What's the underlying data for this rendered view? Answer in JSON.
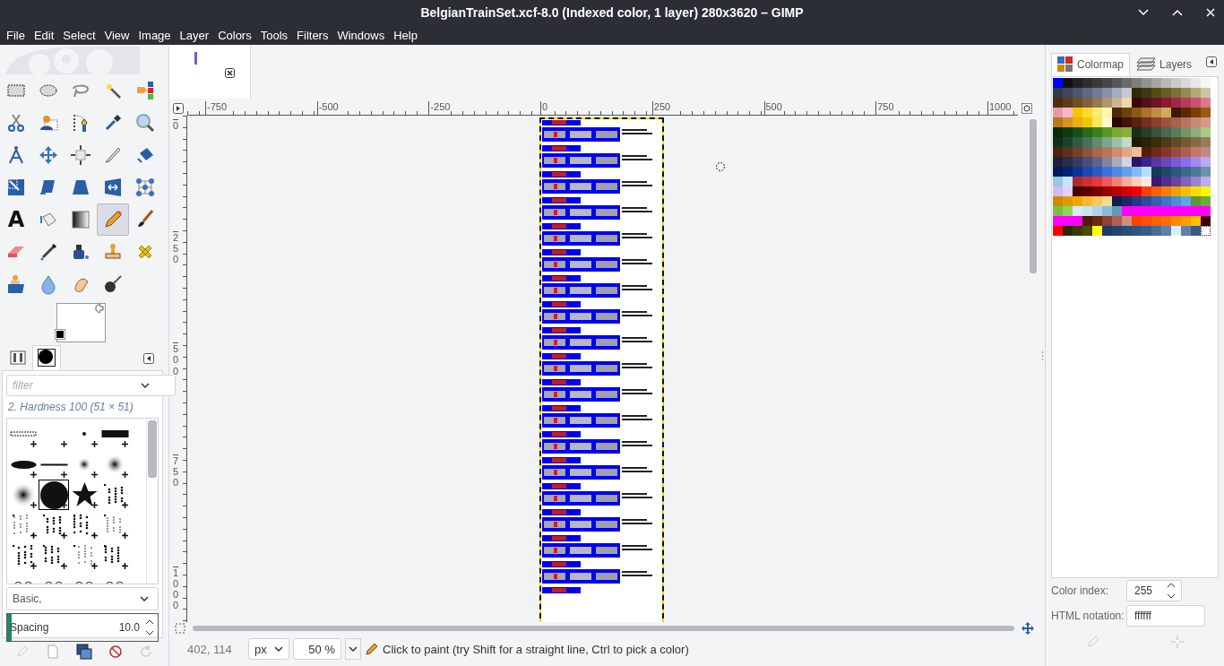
{
  "window": {
    "title": "BelgianTrainSet.xcf-8.0 (Indexed color, 1 layer) 280x3620 – GIMP"
  },
  "menu": [
    "File",
    "Edit",
    "Select",
    "View",
    "Image",
    "Layer",
    "Colors",
    "Tools",
    "Filters",
    "Windows",
    "Help"
  ],
  "toolbox": {
    "tools": [
      {
        "selected": false
      },
      {
        "selected": false
      },
      {
        "selected": false
      },
      {
        "selected": false
      },
      {
        "selected": false
      },
      {
        "selected": false
      },
      {
        "selected": false
      },
      {
        "selected": false
      },
      {
        "selected": false
      },
      {
        "selected": false
      },
      {
        "selected": false
      },
      {
        "selected": false
      },
      {
        "selected": false
      },
      {
        "selected": false
      },
      {
        "selected": false
      },
      {
        "selected": false
      },
      {
        "selected": false
      },
      {
        "selected": false
      },
      {
        "selected": false
      },
      {
        "selected": false
      },
      {
        "selected": false,
        "glyph": "A"
      },
      {
        "selected": false
      },
      {
        "selected": false
      },
      {
        "selected": true
      },
      {
        "selected": false
      },
      {
        "selected": false
      },
      {
        "selected": false
      },
      {
        "selected": false
      },
      {
        "selected": false
      },
      {
        "selected": false
      },
      {
        "selected": false
      },
      {
        "selected": false
      },
      {
        "selected": false
      },
      {
        "selected": false
      }
    ],
    "foreground": {
      "color": "#ffffff"
    },
    "background": {
      "color": "#000000"
    }
  },
  "left_dock": {
    "tabs": [
      {
        "selected": false
      },
      {
        "selected": true
      }
    ],
    "filter": {
      "placeholder": "filter"
    },
    "brush_name": "2. Hardness 100 (51 × 51)",
    "brushes": [
      {
        "selected": false
      },
      {
        "selected": false
      },
      {
        "selected": false
      },
      {
        "selected": false
      },
      {
        "selected": false
      },
      {
        "selected": false
      },
      {
        "selected": false
      },
      {
        "selected": false
      },
      {
        "selected": false
      },
      {
        "selected": true
      },
      {
        "selected": false
      },
      {
        "selected": false
      },
      {
        "selected": false
      },
      {
        "selected": false
      },
      {
        "selected": false
      },
      {
        "selected": false
      },
      {
        "selected": false
      },
      {
        "selected": false
      },
      {
        "selected": false
      },
      {
        "selected": false
      },
      {
        "selected": false
      },
      {
        "selected": false
      },
      {
        "selected": false
      },
      {
        "selected": false
      }
    ],
    "tag_filter": "Basic,",
    "spacing": {
      "label": "Spacing",
      "value": "10.0",
      "level": 0.03
    }
  },
  "rulers": {
    "horizontal": [
      "-750",
      "-500",
      "-250",
      "0",
      "250",
      "500",
      "750",
      "1000"
    ],
    "vertical": [
      "0",
      "250",
      "500",
      "750",
      "1000"
    ]
  },
  "status_bar": {
    "coordinates": "402, 114",
    "unit": "px",
    "zoom": "50 %",
    "message": "Click to paint (try Shift for a straight line, Ctrl to pick a color)"
  },
  "right_dock": {
    "tabs": [
      {
        "label": "Colormap",
        "selected": true
      },
      {
        "label": "Layers",
        "selected": false
      }
    ],
    "colormap": [
      [
        {
          "color": "#0000ff"
        },
        {
          "color": "#111111"
        },
        {
          "color": "#222222"
        },
        {
          "color": "#2e2e2e"
        },
        {
          "color": "#3a3a3a"
        },
        {
          "color": "#474747"
        },
        {
          "color": "#575757"
        },
        {
          "color": "#6a6a6a"
        },
        {
          "color": "#7d7d7d"
        },
        {
          "color": "#919191"
        },
        {
          "color": "#a5a5a5"
        },
        {
          "color": "#b8b8b8"
        },
        {
          "color": "#cacaca"
        },
        {
          "color": "#dadada"
        },
        {
          "color": "#e8e8e8"
        },
        {
          "color": "#f6f6f6"
        }
      ],
      [
        {
          "color": "#333a4a"
        },
        {
          "color": "#3f4659"
        },
        {
          "color": "#4e566c"
        },
        {
          "color": "#5f6880"
        },
        {
          "color": "#707a94"
        },
        {
          "color": "#8891a8"
        },
        {
          "color": "#a5adc0"
        },
        {
          "color": "#c4c9d6"
        },
        {
          "color": "#2e2a0a"
        },
        {
          "color": "#3e3a10"
        },
        {
          "color": "#524c18"
        },
        {
          "color": "#675f22"
        },
        {
          "color": "#7a7236"
        },
        {
          "color": "#938b55"
        },
        {
          "color": "#aea977"
        },
        {
          "color": "#c9c6a0"
        }
      ],
      [
        {
          "color": "#4a3010"
        },
        {
          "color": "#5c3d17"
        },
        {
          "color": "#6f4e25"
        },
        {
          "color": "#806139"
        },
        {
          "color": "#967752"
        },
        {
          "color": "#b09470"
        },
        {
          "color": "#cfb48f"
        },
        {
          "color": "#f0d9a8"
        },
        {
          "color": "#3a0a0a"
        },
        {
          "color": "#55101a"
        },
        {
          "color": "#6e1425"
        },
        {
          "color": "#881c33"
        },
        {
          "color": "#a02a45"
        },
        {
          "color": "#b43d59"
        },
        {
          "color": "#c8536e"
        },
        {
          "color": "#db7a8d"
        }
      ],
      [
        {
          "color": "#e898a8"
        },
        {
          "color": "#f6b8c6"
        },
        {
          "color": "#f5c400"
        },
        {
          "color": "#f8dc30"
        },
        {
          "color": "#f8ec70"
        },
        {
          "color": "#fbf6b0"
        },
        {
          "color": "#4a2a0a"
        },
        {
          "color": "#6a4210"
        },
        {
          "color": "#8a5a18"
        },
        {
          "color": "#a87428"
        },
        {
          "color": "#c08e40"
        },
        {
          "color": "#cfaa66"
        },
        {
          "color": "#3a1a00"
        },
        {
          "color": "#5a2a00"
        },
        {
          "color": "#7a3e00"
        },
        {
          "color": "#9a5a10"
        }
      ],
      [
        {
          "color": "#b87818"
        },
        {
          "color": "#d49620"
        },
        {
          "color": "#e8b010"
        },
        {
          "color": "#f0c800"
        },
        {
          "color": "#f8e858"
        },
        {
          "color": "#fcf8c8"
        },
        {
          "color": "#280800"
        },
        {
          "color": "#401408"
        },
        {
          "color": "#5a2010"
        },
        {
          "color": "#743020"
        },
        {
          "color": "#8a4030"
        },
        {
          "color": "#9c5240"
        },
        {
          "color": "#a86250"
        },
        {
          "color": "#b87462"
        },
        {
          "color": "#c8887a"
        },
        {
          "color": "#d09a8a"
        }
      ],
      [
        {
          "color": "#0a2a0a"
        },
        {
          "color": "#0e3a0e"
        },
        {
          "color": "#16501a"
        },
        {
          "color": "#286a16"
        },
        {
          "color": "#3e7e1a"
        },
        {
          "color": "#5a9426"
        },
        {
          "color": "#7aa830"
        },
        {
          "color": "#8aae3a"
        },
        {
          "color": "#1a2e1a"
        },
        {
          "color": "#28402a"
        },
        {
          "color": "#38543a"
        },
        {
          "color": "#4a684c"
        },
        {
          "color": "#5c7c58"
        },
        {
          "color": "#74946a"
        },
        {
          "color": "#8eac7e"
        },
        {
          "color": "#aecb86"
        }
      ],
      [
        {
          "color": "#0e2e1e"
        },
        {
          "color": "#1e4030"
        },
        {
          "color": "#305846"
        },
        {
          "color": "#467060"
        },
        {
          "color": "#608a76"
        },
        {
          "color": "#7ca690"
        },
        {
          "color": "#9cc0a8"
        },
        {
          "color": "#bedcc6"
        },
        {
          "color": "#1e1a08"
        },
        {
          "color": "#2c2008"
        },
        {
          "color": "#3e2c0e"
        },
        {
          "color": "#503a18"
        },
        {
          "color": "#624a26"
        },
        {
          "color": "#745a34"
        },
        {
          "color": "#866a44"
        },
        {
          "color": "#9a7c58"
        }
      ],
      [
        {
          "color": "#4a2410"
        },
        {
          "color": "#5e3018"
        },
        {
          "color": "#744028"
        },
        {
          "color": "#8a5440"
        },
        {
          "color": "#a8664a"
        },
        {
          "color": "#b87458"
        },
        {
          "color": "#cc8c6e"
        },
        {
          "color": "#e0a684"
        },
        {
          "color": "#eebc96"
        },
        {
          "color": "#561c0e"
        },
        {
          "color": "#6e2a1a"
        },
        {
          "color": "#84382a"
        },
        {
          "color": "#9a4a3e"
        },
        {
          "color": "#ae5e54"
        },
        {
          "color": "#c27870"
        },
        {
          "color": "#c08888"
        }
      ],
      [
        {
          "color": "#20203e"
        },
        {
          "color": "#2a2c50"
        },
        {
          "color": "#383c64"
        },
        {
          "color": "#4a4e78"
        },
        {
          "color": "#5e6290"
        },
        {
          "color": "#80869e"
        },
        {
          "color": "#a8aac0"
        },
        {
          "color": "#d2d4e0"
        },
        {
          "color": "#28146a"
        },
        {
          "color": "#3c2290"
        },
        {
          "color": "#5636a8"
        },
        {
          "color": "#6a48c0"
        },
        {
          "color": "#7c5ad4"
        },
        {
          "color": "#8e6ee8"
        },
        {
          "color": "#a08af0"
        },
        {
          "color": "#b8a8f8"
        }
      ],
      [
        {
          "color": "#001a5a"
        },
        {
          "color": "#002478"
        },
        {
          "color": "#0a3494"
        },
        {
          "color": "#1a48b0"
        },
        {
          "color": "#2a5cc8"
        },
        {
          "color": "#3c72dc"
        },
        {
          "color": "#4a8ae8"
        },
        {
          "color": "#60a0f0"
        },
        {
          "color": "#80bcf8"
        },
        {
          "color": "#b8dcfc"
        },
        {
          "color": "#1a3a5a"
        },
        {
          "color": "#1e4a68"
        },
        {
          "color": "#2a5a78"
        },
        {
          "color": "#3a6a88"
        },
        {
          "color": "#4a7a98"
        },
        {
          "color": "#6a92a8"
        }
      ],
      [
        {
          "color": "#98c8e0"
        },
        {
          "color": "#c4e8f8"
        },
        {
          "color": "#b02828"
        },
        {
          "color": "#d03030"
        },
        {
          "color": "#e83838"
        },
        {
          "color": "#f05858"
        },
        {
          "color": "#f88070"
        },
        {
          "color": "#fcac98"
        },
        {
          "color": "#fcd0c0"
        },
        {
          "color": "#fcece0"
        },
        {
          "color": "#3a1878"
        },
        {
          "color": "#503090"
        },
        {
          "color": "#6844a8"
        },
        {
          "color": "#8060c0"
        },
        {
          "color": "#9c80d8"
        },
        {
          "color": "#c0a8ec"
        }
      ],
      [
        {
          "color": "#d4b8f8"
        },
        {
          "color": "#e4d0fc"
        },
        {
          "color": "#400000"
        },
        {
          "color": "#5a0000"
        },
        {
          "color": "#780000"
        },
        {
          "color": "#980000"
        },
        {
          "color": "#b80000"
        },
        {
          "color": "#d80000"
        },
        {
          "color": "#f00000"
        },
        {
          "color": "#f84000"
        },
        {
          "color": "#f86000"
        },
        {
          "color": "#f88000"
        },
        {
          "color": "#f8a000"
        },
        {
          "color": "#f8c000"
        },
        {
          "color": "#f8e000"
        },
        {
          "color": "#f8f800"
        }
      ],
      [
        {
          "color": "#d08800"
        },
        {
          "color": "#e09a00"
        },
        {
          "color": "#f0a800"
        },
        {
          "color": "#f8b830"
        },
        {
          "color": "#f8c858"
        },
        {
          "color": "#f8d890"
        },
        {
          "color": "#101c50"
        },
        {
          "color": "#182a68"
        },
        {
          "color": "#203a80"
        },
        {
          "color": "#284c98"
        },
        {
          "color": "#3062b0"
        },
        {
          "color": "#3878c8"
        },
        {
          "color": "#4890d8"
        },
        {
          "color": "#58a8e8"
        },
        {
          "color": "#5a9a30"
        },
        {
          "color": "#6aae3a"
        }
      ],
      [
        {
          "color": "#78c040"
        },
        {
          "color": "#90d458"
        },
        {
          "color": "#d8ecf8"
        },
        {
          "color": "#c8e4f0"
        },
        {
          "color": "#b0d4e8"
        },
        {
          "color": "#88bcd8"
        },
        {
          "color": "#5e9cb8"
        },
        {
          "color": "#ff00ff"
        },
        {
          "color": "#ff00ff"
        },
        {
          "color": "#ff00ff"
        },
        {
          "color": "#ff00ff"
        },
        {
          "color": "#ff00ff"
        },
        {
          "color": "#ff00ff"
        },
        {
          "color": "#ff00ff"
        },
        {
          "color": "#ff00ff"
        },
        {
          "color": "#ff00ff"
        }
      ],
      [
        {
          "color": "#ff00ff"
        },
        {
          "color": "#ff00ff"
        },
        {
          "color": "#ff00ff"
        },
        {
          "color": "#4a1a0a"
        },
        {
          "color": "#6a2818"
        },
        {
          "color": "#904030"
        },
        {
          "color": "#b06050"
        },
        {
          "color": "#d09080"
        },
        {
          "color": "#ff4000"
        },
        {
          "color": "#ff5000"
        },
        {
          "color": "#ff6000"
        },
        {
          "color": "#ff7000"
        },
        {
          "color": "#ff8800"
        },
        {
          "color": "#ffa000"
        },
        {
          "color": "#ffc000"
        },
        {
          "color": "#400000"
        }
      ],
      [
        {
          "color": "#ff0000"
        },
        {
          "color": "#2a2a00"
        },
        {
          "color": "#3a3a00"
        },
        {
          "color": "#4a4a00"
        },
        {
          "color": "#ffff00"
        },
        {
          "color": "#1e3c6a"
        },
        {
          "color": "#244470"
        },
        {
          "color": "#2a4c78"
        },
        {
          "color": "#2e5480"
        },
        {
          "color": "#345c88"
        },
        {
          "color": "#4a6a98"
        },
        {
          "color": "#6080a8"
        },
        {
          "color": "#d8f0fc"
        },
        {
          "color": "#6080a8"
        },
        {
          "color": "#3a5a8a"
        },
        {
          "color": "#ffffff"
        }
      ]
    ],
    "color_index": {
      "label": "Color index:",
      "value": "255"
    },
    "html_notation": {
      "label": "HTML notation:",
      "value": "ffffff"
    }
  }
}
